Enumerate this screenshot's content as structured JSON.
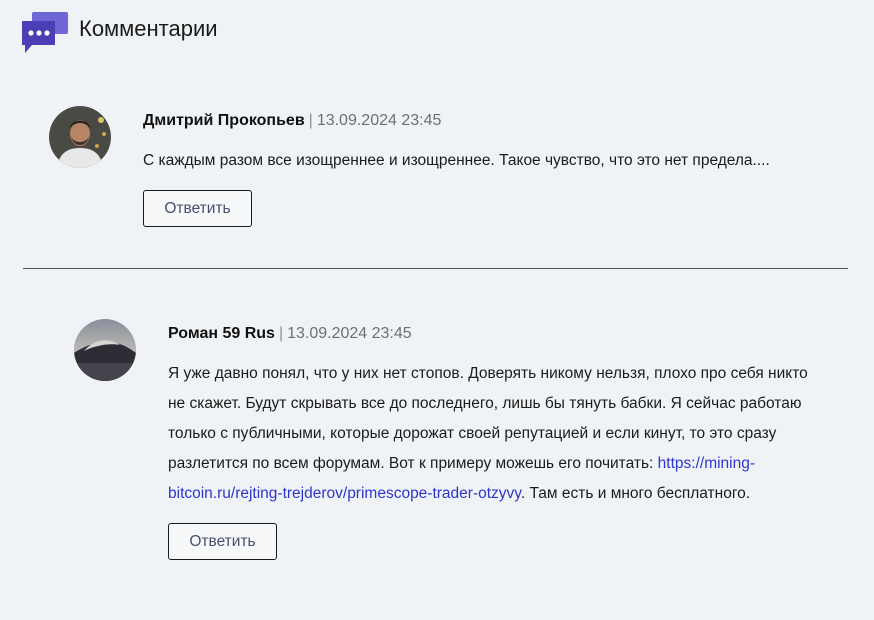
{
  "section": {
    "title": "Комментарии",
    "icon": "chat-bubble-icon"
  },
  "comments": [
    {
      "author": "Дмитрий Прокопьев",
      "date": "13.09.2024 23:45",
      "text": "С каждым разом все изощреннее и изощреннее. Такое чувство, что это нет предела....",
      "reply_label": "Ответить"
    },
    {
      "author": "Роман 59 Rus",
      "date": "13.09.2024 23:45",
      "text_before": "Я уже давно понял, что у них нет стопов. Доверять никому нельзя, плохо про себя никто не скажет. Будут скрывать все до последнего, лишь бы тянуть бабки. Я сейчас работаю только с публичными, которые дорожат своей репутацией и если кинут, то это сразу разлетится по всем форумам. Вот к примеру можешь его почитать: ",
      "link": "https://mining-bitcoin.ru/rejting-trejderov/primescope-trader-otzyvy",
      "text_after": ". Там есть и много бесплатного.",
      "reply_label": "Ответить"
    }
  ],
  "separator": "|",
  "colors": {
    "background": "#f0f3f6",
    "accent": "#4a3fb5",
    "link": "#2e35c9"
  }
}
